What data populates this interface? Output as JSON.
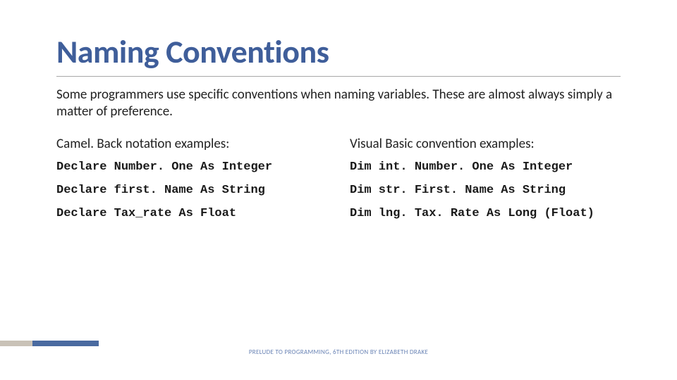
{
  "title": "Naming Conventions",
  "intro": "Some programmers use specific conventions when naming variables. These are almost always simply a matter of preference.",
  "left": {
    "heading": "Camel. Back notation examples:",
    "lines": [
      "Declare Number. One As Integer",
      "Declare first. Name As String",
      "Declare Tax_rate As Float"
    ]
  },
  "right": {
    "heading": "Visual Basic convention examples:",
    "lines": [
      "Dim int. Number. One As Integer",
      "Dim str. First. Name As String",
      "Dim lng. Tax. Rate As Long (Float)"
    ]
  },
  "footer": "PRELUDE TO PROGRAMMING, 6TH EDITION BY ELIZABETH DRAKE"
}
